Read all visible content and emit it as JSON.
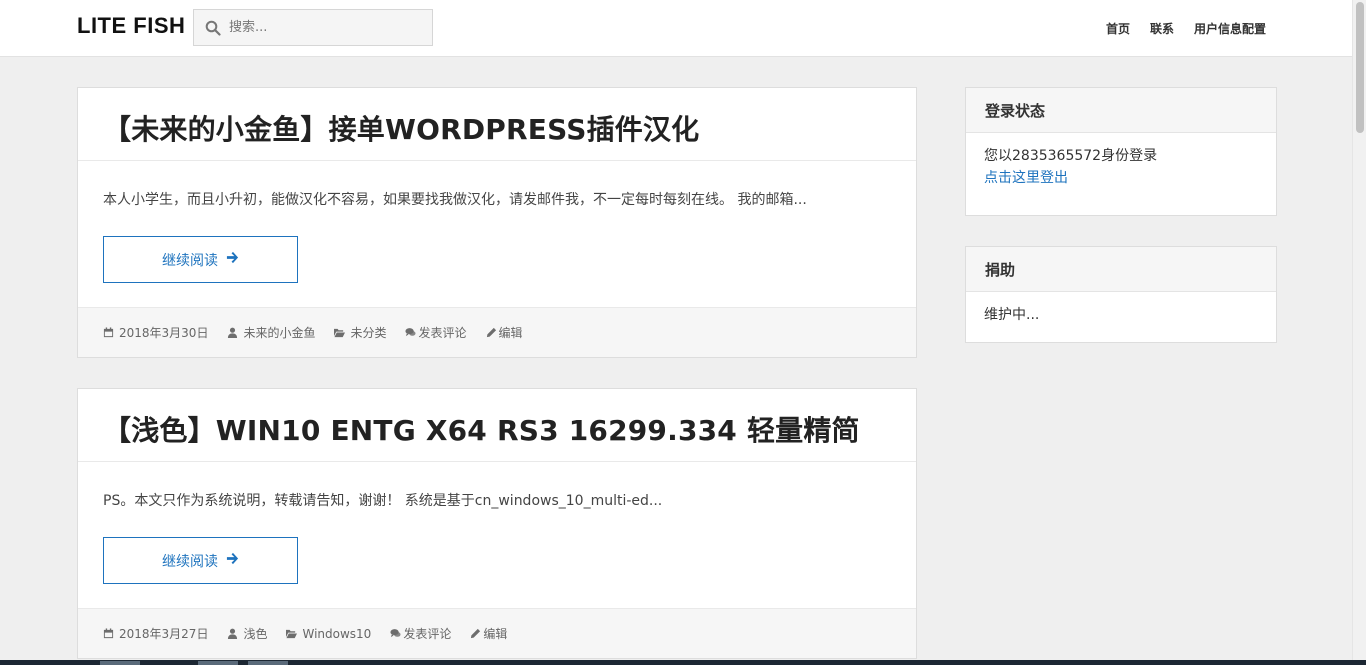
{
  "header": {
    "brand": "LITE FISH",
    "search_placeholder": "搜索...",
    "nav": [
      "首页",
      "联系",
      "用户信息配置"
    ]
  },
  "posts": [
    {
      "title": "【未来的小金鱼】接单WORDPRESS插件汉化",
      "excerpt": "本人小学生，而且小升初，能做汉化不容易，如果要找我做汉化，请发邮件我，不一定每时每刻在线。 我的邮箱...",
      "read_more": "继续阅读",
      "date": "2018年3月30日",
      "author": "未来的小金鱼",
      "category": "未分类",
      "comment": "发表评论",
      "edit": "编辑"
    },
    {
      "title": "【浅色】WIN10 ENTG X64 RS3 16299.334 轻量精简",
      "excerpt": "PS。本文只作为系统说明，转载请告知，谢谢！ 系统是基于cn_windows_10_multi-ed...",
      "read_more": "继续阅读",
      "date": "2018年3月27日",
      "author": "浅色",
      "category": "Windows10",
      "comment": "发表评论",
      "edit": "编辑"
    }
  ],
  "sidebar": {
    "login": {
      "title": "登录状态",
      "status": "您以2835365572身份登录",
      "logout": "点击这里登出"
    },
    "donate": {
      "title": "捐助",
      "text": "维护中..."
    }
  },
  "colors": {
    "accent": "#1e73be",
    "background": "#efefef"
  }
}
